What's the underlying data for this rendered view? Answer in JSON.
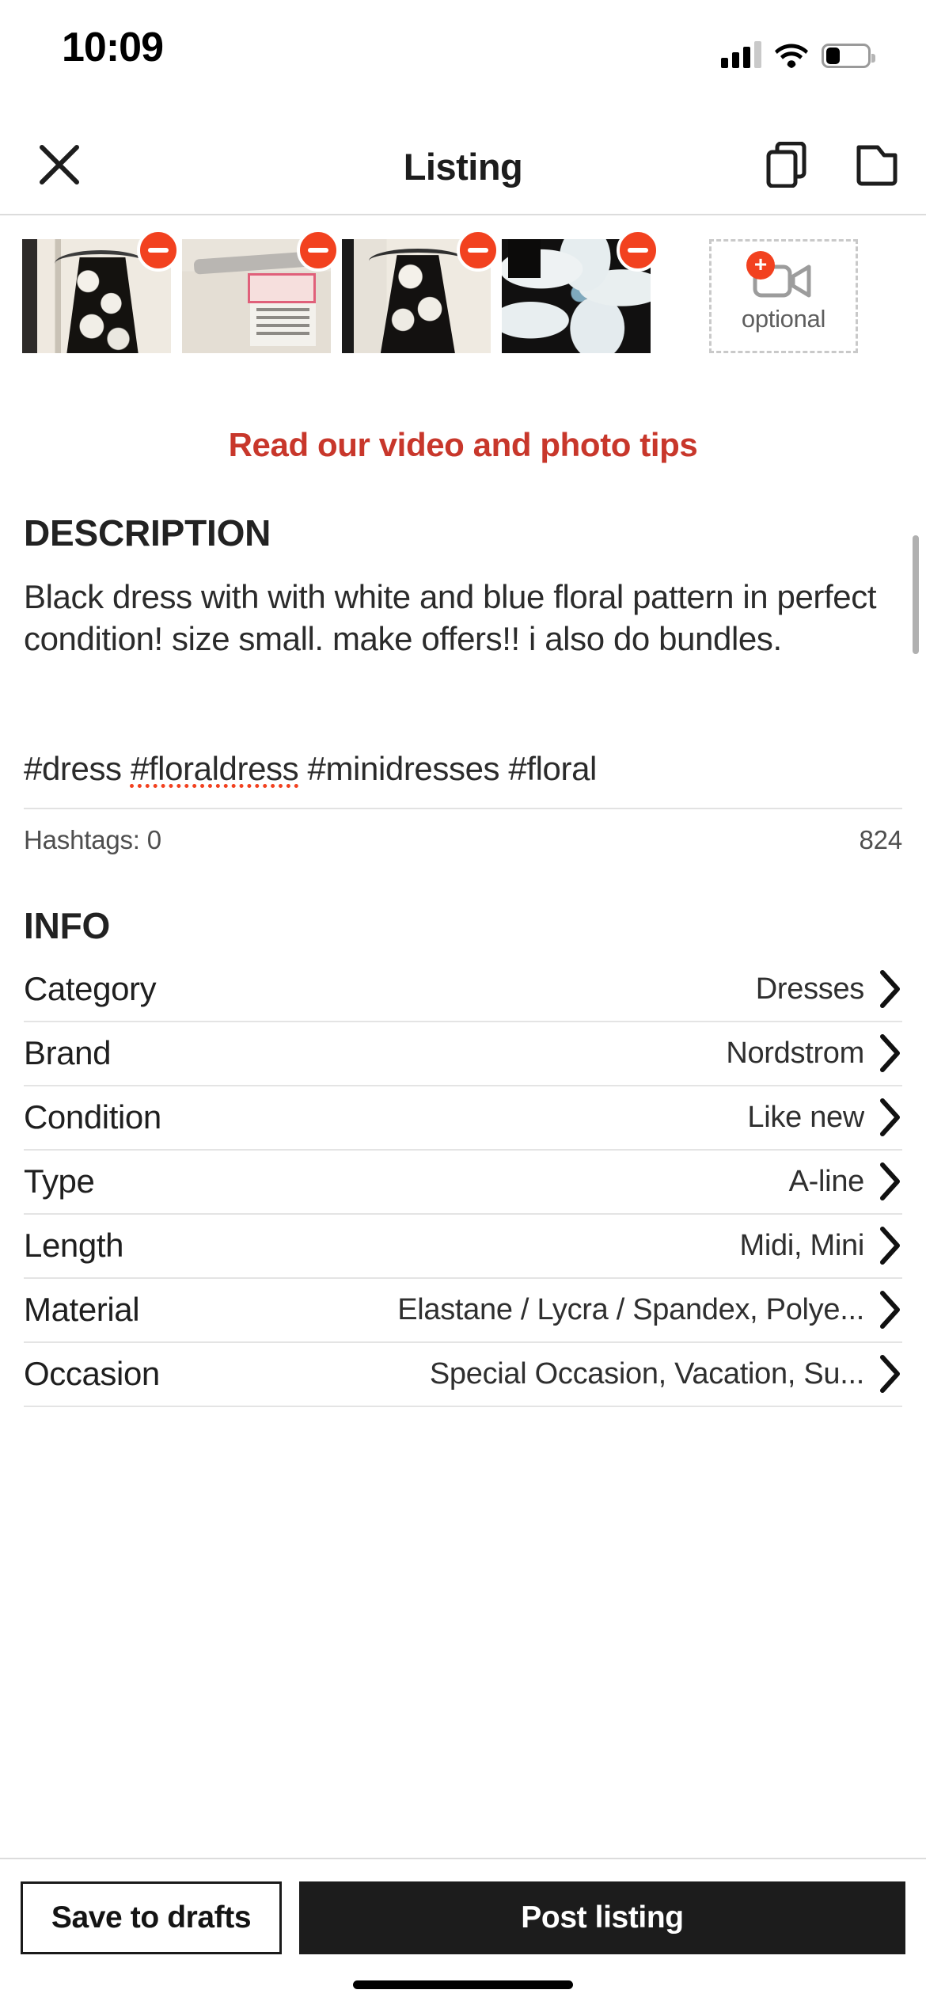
{
  "status_bar": {
    "time": "10:09",
    "signal_icon": "signal-bars-icon",
    "signal_bars_filled": 3,
    "signal_bars_total": 4,
    "wifi_icon": "wifi-icon",
    "battery_icon": "battery-icon",
    "battery_level_pct": 32
  },
  "header": {
    "title": "Listing",
    "close_icon": "close-icon",
    "duplicate_icon": "duplicate-icon",
    "folder_icon": "folder-icon"
  },
  "photos": {
    "remove_badge_icon": "minus-circle-icon",
    "items": [
      {
        "alt": "Black and white floral dress on hanger"
      },
      {
        "alt": "Garment size and care label close-up"
      },
      {
        "alt": "Black floral dress hanging on door frame"
      },
      {
        "alt": "Close-up of blue and white floral print"
      }
    ],
    "video_tile": {
      "label": "optional",
      "video_icon": "video-camera-icon",
      "add_icon": "plus-circle-icon"
    },
    "tips_link": "Read our video and photo tips",
    "accent_red": "#f2411f",
    "link_red": "#c8372b"
  },
  "description": {
    "heading": "DESCRIPTION",
    "text": "Black dress with with white and blue floral pattern in perfect condition! size small. make offers!! i also do bundles.",
    "hashtags_pre": "#dress ",
    "hashtags_misspelled": "#floraldress",
    "hashtags_post": " #minidresses #floral",
    "hashtags_count_label": "Hashtags: 0",
    "chars_remaining": "824"
  },
  "info": {
    "heading": "INFO",
    "chevron_icon": "chevron-right-icon",
    "rows": [
      {
        "label": "Category",
        "value": "Dresses"
      },
      {
        "label": "Brand",
        "value": "Nordstrom"
      },
      {
        "label": "Condition",
        "value": "Like new"
      },
      {
        "label": "Type",
        "value": "A-line"
      },
      {
        "label": "Length",
        "value": "Midi, Mini"
      },
      {
        "label": "Material",
        "value": "Elastane / Lycra / Spandex, Polye..."
      },
      {
        "label": "Occasion",
        "value": "Special Occasion, Vacation, Su..."
      }
    ]
  },
  "footer": {
    "save_draft_label": "Save to drafts",
    "post_label": "Post listing"
  }
}
